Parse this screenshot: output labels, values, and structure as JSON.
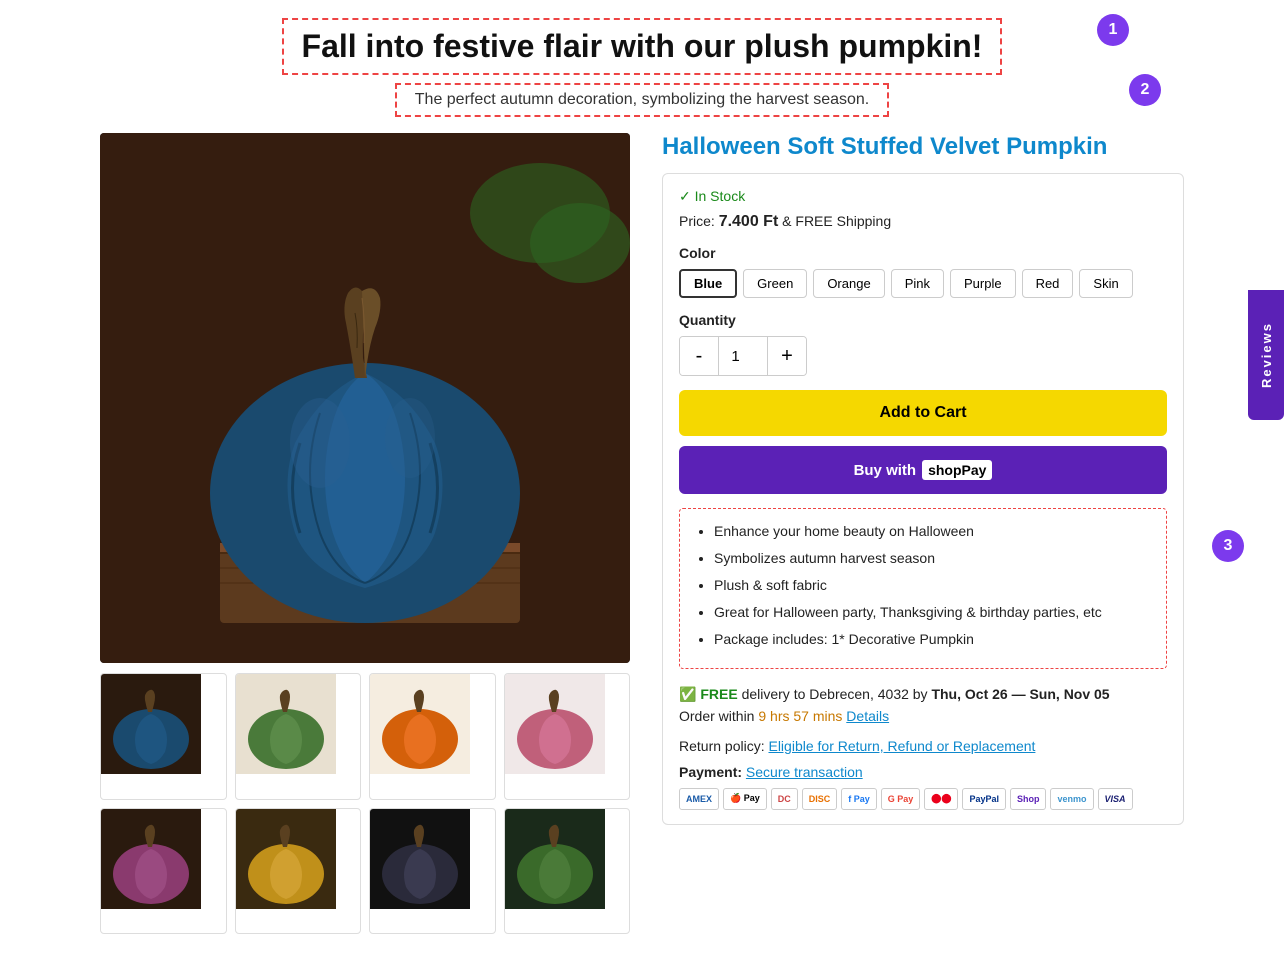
{
  "banner": {
    "heading": "Fall into festive flair with our plush pumpkin!",
    "subheading": "The perfect autumn decoration, symbolizing the harvest season.",
    "badge1": "1",
    "badge2": "2",
    "badge3": "3"
  },
  "reviews_tab": "Reviews",
  "product": {
    "title": "Halloween Soft Stuffed Velvet Pumpkin",
    "in_stock": "✓ In Stock",
    "price_label": "Price:",
    "price_value": "7.400 Ft",
    "free_shipping": "& FREE Shipping",
    "color_label": "Color",
    "colors": [
      "Blue",
      "Green",
      "Orange",
      "Pink",
      "Purple",
      "Red",
      "Skin"
    ],
    "active_color": "Blue",
    "quantity_label": "Quantity",
    "quantity_value": "1",
    "qty_minus": "-",
    "qty_plus": "+",
    "add_to_cart": "Add to Cart",
    "buy_now": "Buy with",
    "shop_pay": "ShopPay",
    "features": [
      "Enhance your home beauty on Halloween",
      "Symbolizes autumn harvest season",
      "Plush & soft fabric",
      "Great for Halloween party, Thanksgiving & birthday parties, etc",
      "Package includes: 1* Decorative Pumpkin"
    ],
    "delivery_free": "FREE",
    "delivery_text": "delivery to Debrecen, 4032 by",
    "delivery_dates": "Thu, Oct 26 — Sun, Nov 05",
    "order_within_label": "Order within",
    "order_within_time": "9 hrs 57 mins",
    "details": "Details",
    "return_policy_label": "Return policy:",
    "return_policy_link": "Eligible for Return, Refund or Replacement",
    "payment_label": "Payment:",
    "secure_transaction": "Secure transaction",
    "payment_methods": [
      "AMEX",
      "Apple Pay",
      "Diners",
      "Discover",
      "Meta Pay",
      "Google Pay",
      "Mastercard",
      "PayPal",
      "Shop",
      "Venmo",
      "VISA"
    ]
  }
}
